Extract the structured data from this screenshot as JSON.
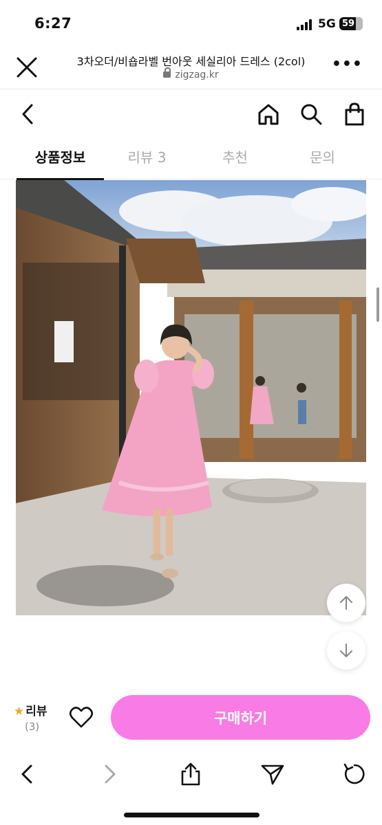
{
  "status_bar": {
    "time": "6:27",
    "network": "5G",
    "battery": "59"
  },
  "browser": {
    "page_title": "3차오더/비숍라벨 번아웃 세실리아 드레스 (2col)",
    "url": "zigzag.kr",
    "close_icon": "close-icon",
    "more_icon": "more-dots-icon"
  },
  "header": {
    "back_icon": "chevron-left-icon",
    "home_icon": "home-icon",
    "search_icon": "search-icon",
    "cart_icon": "shopping-bag-icon"
  },
  "tabs": [
    {
      "label": "상품정보",
      "active": true
    },
    {
      "label": "리뷰 3",
      "active": false
    },
    {
      "label": "추천",
      "active": false
    },
    {
      "label": "문의",
      "active": false
    }
  ],
  "product": {
    "image_icon": "product-photo",
    "scroll_up_icon": "arrow-up-icon",
    "scroll_down_icon": "arrow-down-icon"
  },
  "purchase_bar": {
    "review_label": "리뷰",
    "review_count": "(3)",
    "like_icon": "heart-icon",
    "buy_label": "구매하기",
    "buy_color": "#f97be5"
  },
  "toolbar": {
    "back_icon": "chevron-left-icon",
    "forward_icon": "chevron-right-icon",
    "share_icon": "share-icon",
    "send_icon": "send-icon",
    "reload_icon": "reload-icon"
  }
}
